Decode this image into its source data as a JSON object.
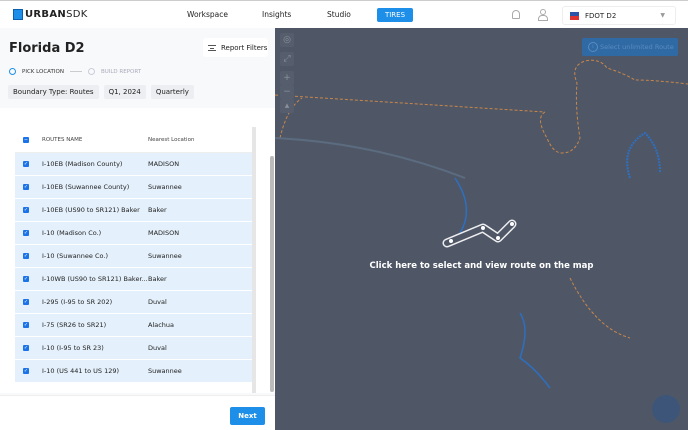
{
  "nav": {
    "logo_bold": "URBAN",
    "logo_light": "SDK",
    "links": [
      "Workspace",
      "Insights",
      "Studio"
    ],
    "active": "TIRES",
    "org": "FDOT D2"
  },
  "panel": {
    "title": "Florida D2",
    "report_filters": "Report Filters",
    "steps": [
      "PICK LOCATION",
      "BUILD REPORT"
    ],
    "chips": [
      "Boundary Type: Routes",
      "Q1, 2024",
      "Quarterly"
    ],
    "columns": [
      "ROUTES NAME",
      "Nearest Location"
    ],
    "rows": [
      {
        "name": "I-10EB (Madison County)",
        "loc": "MADISON"
      },
      {
        "name": "I-10EB (Suwannee County)",
        "loc": "Suwannee"
      },
      {
        "name": "I-10EB (US90 to SR121) Baker",
        "loc": "Baker"
      },
      {
        "name": "I-10 (Madison Co.)",
        "loc": "MADISON"
      },
      {
        "name": "I-10 (Suwannee Co.)",
        "loc": "Suwannee"
      },
      {
        "name": "I-10WB (US90 to SR121) Baker...",
        "loc": "Baker"
      },
      {
        "name": "I-295 (I-95 to SR 202)",
        "loc": "Duval"
      },
      {
        "name": "I-75 (SR26 to SR21)",
        "loc": "Alachua"
      },
      {
        "name": "I-10 (I-95 to SR 23)",
        "loc": "Duval"
      },
      {
        "name": "I-10 (US 441 to US 129)",
        "loc": "Suwannee"
      }
    ],
    "next": "Next"
  },
  "map": {
    "select_unlimited": "Select unlimited Route",
    "cta": "Click here to select and view route on the map"
  },
  "colors": {
    "accent": "#1e8fe8",
    "map_bg": "#4f5767",
    "row_selected": "#e4f0fb"
  }
}
